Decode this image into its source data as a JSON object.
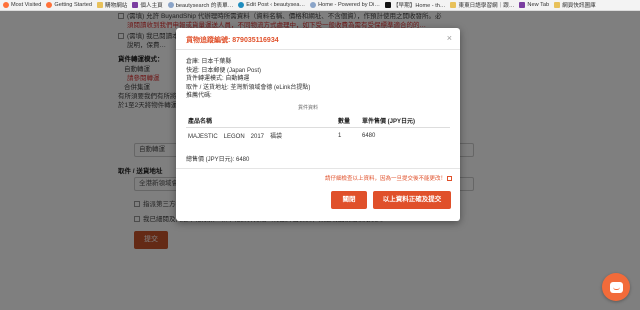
{
  "bookmarks": [
    {
      "label": "Most Visited",
      "icon": "fire-icon",
      "kind": "fire"
    },
    {
      "label": "Getting Started",
      "icon": "firefox-icon",
      "kind": "fire"
    },
    {
      "label": "購物網站",
      "icon": "folder-icon",
      "kind": "folder"
    },
    {
      "label": "個人主頁",
      "icon": "bbox-icon",
      "kind": "bbox"
    },
    {
      "label": "beautysearch 的表單…",
      "icon": "globe-icon",
      "kind": "globe"
    },
    {
      "label": "Edit Post ‹ beautysea…",
      "icon": "wordpress-icon",
      "kind": "wp"
    },
    {
      "label": "Home - Powered by Di…",
      "icon": "globe-icon",
      "kind": "globe"
    },
    {
      "label": "【早期】Home - th…",
      "icon": "z-icon",
      "kind": "z"
    },
    {
      "label": "東東日語學習網｜跟…",
      "icon": "folder-icon",
      "kind": "folder"
    },
    {
      "label": "New Tab",
      "icon": "bbox-icon",
      "kind": "bbox"
    },
    {
      "label": "網頁快訊圖庫",
      "icon": "folder-icon",
      "kind": "folder"
    }
  ],
  "background": {
    "line1": "(需填) 允許 BuyandShip 代辦理時所需資料（資料名稱、價格和網址、不含個資），作預計使用之開收發所。必",
    "line2": "須閱讀收到我們申報或貨量運送人員，不同物流方式處理中，如下受一般收費為需有受保標準適合的的…",
    "line3": "(需填) 我已閱讀本網頁使用條款中有關國際運輸方式時我們的最受通開放及重要建議的國際…",
    "line4": "說明，保費…",
    "section1": "貨件轉運模式：",
    "line5": "自動轉運",
    "line6": "請參閱轉運",
    "line7": "合併集運",
    "line8": "有所須要我們有所將",
    "line9": "於1至2天將物件轉運",
    "select1": "自動轉運",
    "section2": "取件 / 送貨地址",
    "select2": "全港新領域會員",
    "check1": "指派第三方物流收取",
    "check2": "我已細閱及同意申報條款…和本報計算方法（有額外自保費，無運物品及體積限制）。",
    "submit": "提交"
  },
  "modal": {
    "title": "貨物追蹤編號: 879035116934",
    "close_symbol": "×",
    "info": [
      "倉庫: 日本千葉縣",
      "快遞: 日本郵便 (Japan Post)",
      "貨件轉運模式: 自動轉運",
      "取件 / 送貨地址: 荃灣新領域會德 (eLink台提點)",
      "推薦代碼:"
    ],
    "remark": "貨件資料",
    "table": {
      "headers": [
        "產品名稱",
        "數量",
        "單件售價 (JPY日元)"
      ],
      "rows": [
        [
          "MAJESTIC　LEGON　2017　福袋",
          "1",
          "6480"
        ]
      ]
    },
    "total": "總售價 (JPY日元): 6480",
    "warning": "請仔細檢查以上資料，因為一旦提交後不能更改！",
    "buttons": {
      "close": "關閉",
      "confirm": "以上資料正確及提交"
    }
  },
  "colors": {
    "accent": "#e0502a",
    "chat": "#f26b3a"
  }
}
